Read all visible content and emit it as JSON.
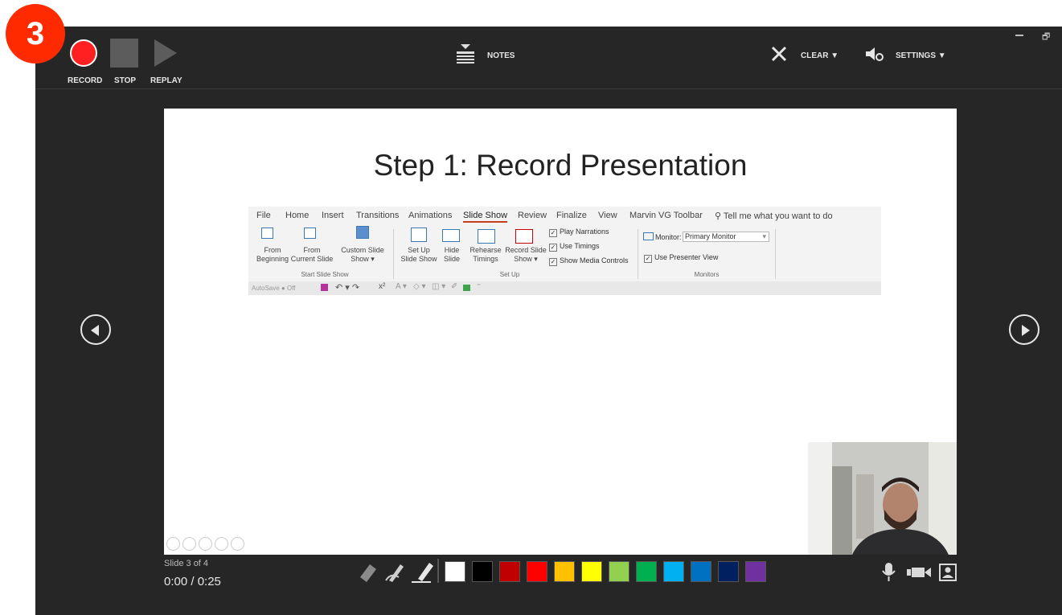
{
  "step_badge": "3",
  "toolbar": {
    "record": "RECORD",
    "stop": "STOP",
    "replay": "REPLAY",
    "notes": "NOTES",
    "clear": "CLEAR ▼",
    "settings": "SETTINGS ▼"
  },
  "slide": {
    "title": "Step 1: Record Presentation",
    "ribbon": {
      "tabs": [
        "File",
        "Home",
        "Insert",
        "Transitions",
        "Animations",
        "Slide Show",
        "Review",
        "Finalize",
        "View",
        "Marvin VG Toolbar",
        "Tell me what you want to do"
      ],
      "active_tab": "Slide Show",
      "commands": {
        "from_beginning": "From\nBeginning",
        "from_current": "From\nCurrent Slide",
        "custom_slide_show": "Custom Slide\nShow ▾",
        "set_up_slide_show": "Set Up\nSlide Show",
        "hide_slide": "Hide\nSlide",
        "rehearse_timings": "Rehearse\nTimings",
        "record_slide_show": "Record Slide\nShow ▾"
      },
      "checks": [
        "Play Narrations",
        "Use Timings",
        "Show Media Controls"
      ],
      "monitor_label": "Monitor:",
      "monitor_value": "Primary Monitor",
      "presenter_view": "Use Presenter View",
      "groups": [
        "Start Slide Show",
        "Set Up",
        "Monitors"
      ],
      "qat_autosave": "AutoSave  ● Off"
    }
  },
  "footer": {
    "slide_count": "Slide 3 of 4",
    "timer": "0:00 / 0:25"
  },
  "colors": {
    "swatches": [
      "#ffffff",
      "#000000",
      "#c00000",
      "#ff0000",
      "#ffc000",
      "#ffff00",
      "#92d050",
      "#00b050",
      "#00b0f0",
      "#0070c0",
      "#002060",
      "#7030a0"
    ]
  }
}
